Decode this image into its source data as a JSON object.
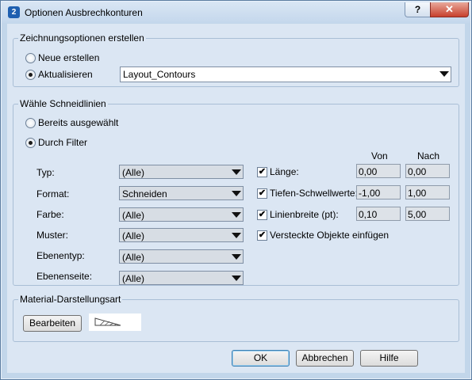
{
  "window": {
    "title": "Optionen Ausbrechkonturen",
    "help_label": "?",
    "close_label": "✕",
    "icon": "app-icon"
  },
  "drawing_group": {
    "legend": "Zeichnungsoptionen erstellen",
    "radio_new": "Neue erstellen",
    "radio_update": "Aktualisieren",
    "layout_value": "Layout_Contours"
  },
  "cut_group": {
    "legend": "Wähle Schneidlinien",
    "radio_selected": "Bereits ausgewählt",
    "radio_filter": "Durch Filter",
    "filters": [
      {
        "label": "Typ:",
        "value": "(Alle)"
      },
      {
        "label": "Format:",
        "value": "Schneiden"
      },
      {
        "label": "Farbe:",
        "value": "(Alle)"
      },
      {
        "label": "Muster:",
        "value": "(Alle)"
      },
      {
        "label": "Ebenentyp:",
        "value": "(Alle)"
      },
      {
        "label": "Ebenenseite:",
        "value": "(Alle)"
      }
    ],
    "col_from": "Von",
    "col_to": "Nach",
    "ranges": [
      {
        "label": "Länge:",
        "checked": true,
        "from": "0,00",
        "to": "0,00"
      },
      {
        "label": "Tiefen-Schwellwerte:",
        "checked": true,
        "from": "-1,00",
        "to": "1,00"
      },
      {
        "label": "Linienbreite (pt):",
        "checked": true,
        "from": "0,10",
        "to": "5,00"
      }
    ],
    "hidden_objects": {
      "label": "Versteckte Objekte einfügen",
      "checked": true
    }
  },
  "material_group": {
    "legend": "Material-Darstellungsart",
    "edit_button": "Bearbeiten"
  },
  "footer": {
    "ok": "OK",
    "cancel": "Abbrechen",
    "help": "Hilfe"
  },
  "check_glyph": "✔"
}
